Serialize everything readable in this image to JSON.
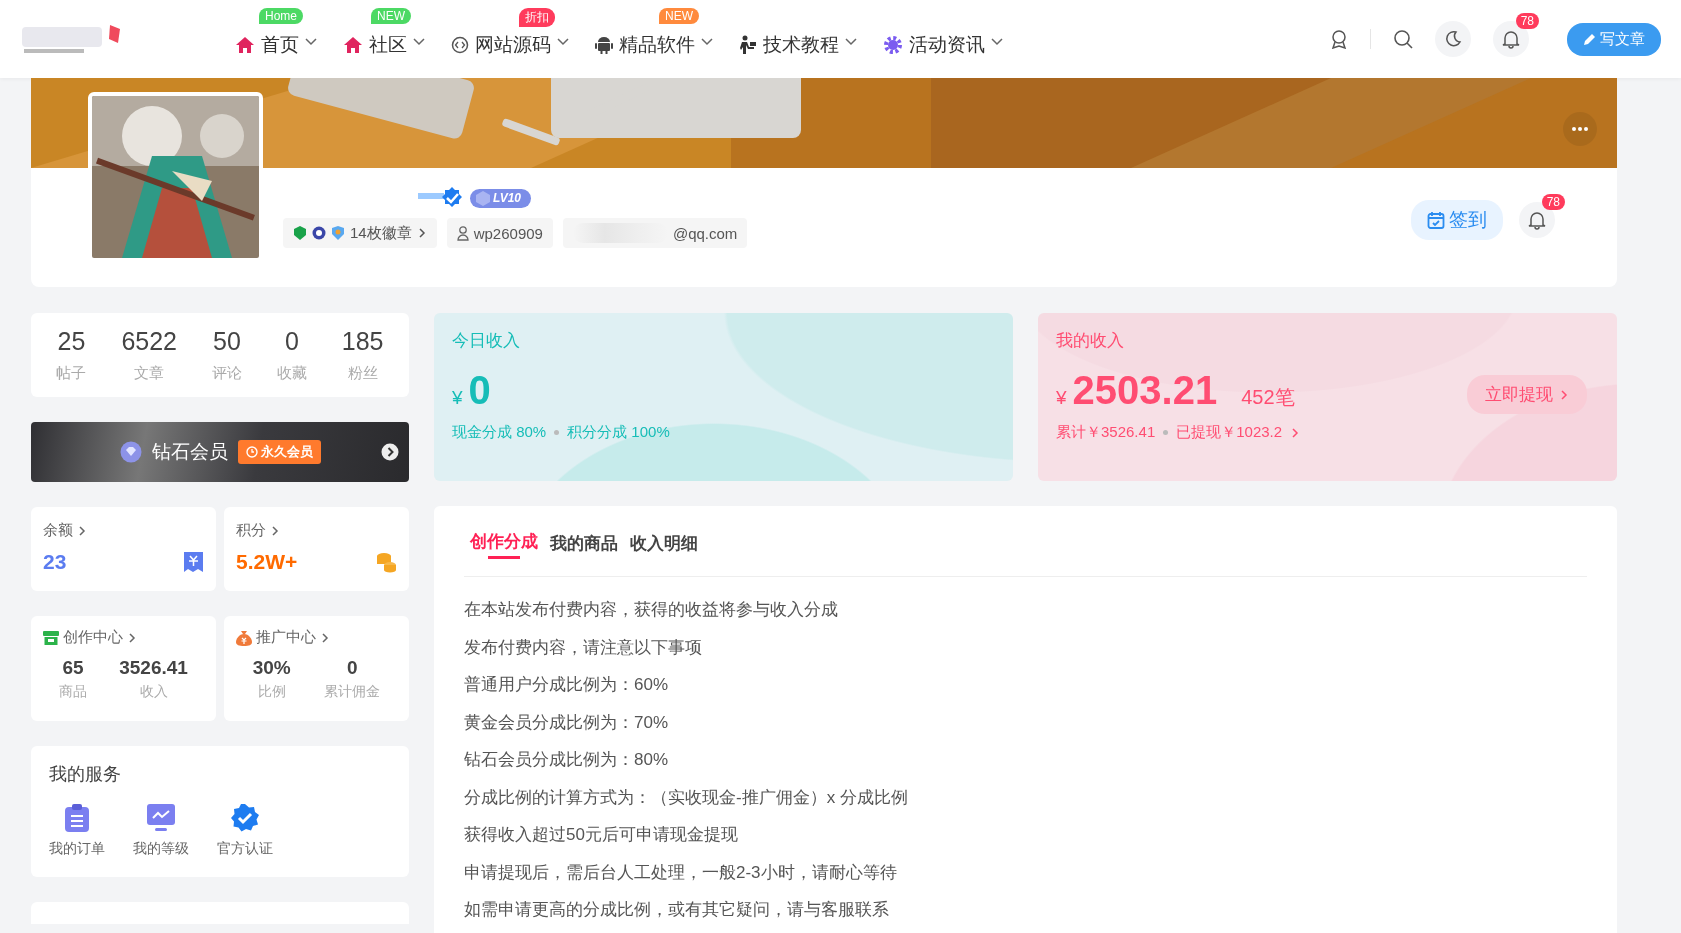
{
  "header": {
    "nav": [
      {
        "label": "首页",
        "badge": "Home",
        "color": "#4cd964",
        "kind": "home",
        "has_menu": true
      },
      {
        "label": "社区",
        "badge": "NEW",
        "color": "#4cd964",
        "kind": "home",
        "has_menu": true
      },
      {
        "label": "网站源码",
        "badge": "折扣",
        "color": "#ff3b5c",
        "kind": "code",
        "has_menu": true
      },
      {
        "label": "精品软件",
        "badge": "NEW",
        "color": "#ff8a3d",
        "kind": "android",
        "has_menu": true
      },
      {
        "label": "技术教程",
        "kind": "study",
        "has_menu": true
      },
      {
        "label": "活动资讯",
        "kind": "gear",
        "has_menu": true
      }
    ],
    "notifications": "78",
    "write_button": "写文章"
  },
  "profile": {
    "level": "LV10",
    "badges_link": "14枚徽章",
    "username": "wp260909",
    "email": "@qq.com",
    "checkin": "签到",
    "notifications": "78"
  },
  "stats": [
    {
      "value": "25",
      "label": "帖子"
    },
    {
      "value": "6522",
      "label": "文章"
    },
    {
      "value": "50",
      "label": "评论"
    },
    {
      "value": "0",
      "label": "收藏"
    },
    {
      "value": "185",
      "label": "粉丝"
    }
  ],
  "vip": {
    "title": "钻石会员",
    "tag": "永久会员"
  },
  "wallet": [
    {
      "label": "余额",
      "value": "23",
      "kind": "balance"
    },
    {
      "label": "积分",
      "value": "5.2W+",
      "kind": "points"
    }
  ],
  "centers": [
    {
      "title": "创作中心",
      "kind": "create",
      "items": [
        {
          "value": "65",
          "label": "商品"
        },
        {
          "value": "3526.41",
          "label": "收入"
        }
      ]
    },
    {
      "title": "推广中心",
      "kind": "promo",
      "items": [
        {
          "value": "30%",
          "label": "比例"
        },
        {
          "value": "0",
          "label": "累计佣金"
        }
      ]
    }
  ],
  "services": {
    "title": "我的服务",
    "items": [
      {
        "label": "我的订单",
        "kind": "order"
      },
      {
        "label": "我的等级",
        "kind": "level"
      },
      {
        "label": "官方认证",
        "kind": "verified"
      }
    ]
  },
  "today_income": {
    "title": "今日收入",
    "currency": "¥",
    "amount": "0",
    "notes": [
      "现金分成 80%",
      "积分分成 100%"
    ]
  },
  "my_income": {
    "title": "我的收入",
    "currency": "¥",
    "amount": "2503.21",
    "count": "452笔",
    "notes": [
      "累计￥3526.41",
      "已提现￥1023.2"
    ],
    "withdraw": "立即提现"
  },
  "tabs": [
    {
      "label": "创作分成",
      "selected": true
    },
    {
      "label": "我的商品",
      "selected": false
    },
    {
      "label": "收入明细",
      "selected": false
    }
  ],
  "rules": [
    "在本站发布付费内容，获得的收益将参与收入分成",
    "发布付费内容，请注意以下事项",
    "普通用户分成比例为：60%",
    "黄金会员分成比例为：70%",
    "钻石会员分成比例为：80%",
    "分成比例的计算方式为：（实收现金-推广佣金）x 分成比例",
    "获得收入超过50元后可申请现金提现",
    "申请提现后，需后台人工处理，一般2-3小时，请耐心等待",
    "如需申请更高的分成比例，或有其它疑问，请与客服联系"
  ]
}
